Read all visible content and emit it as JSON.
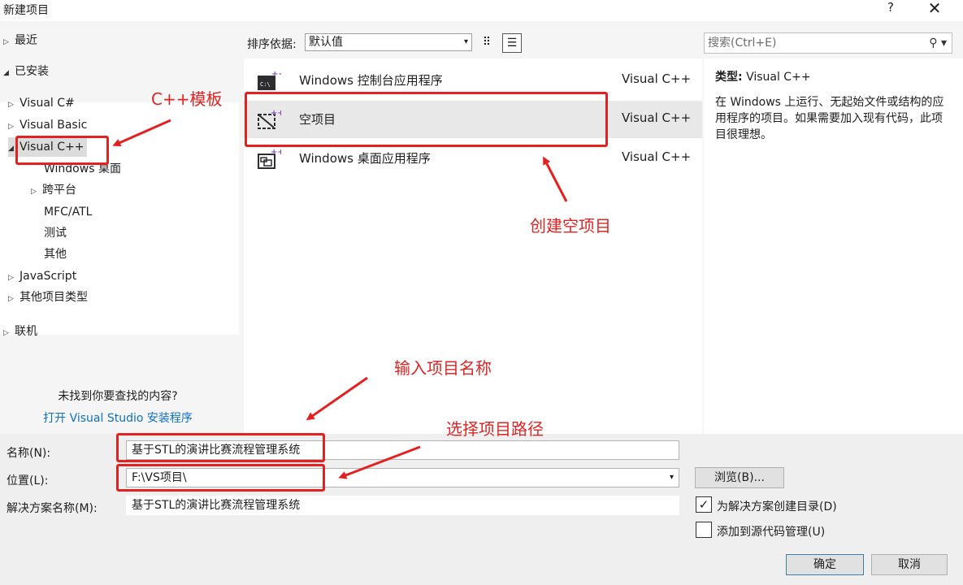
{
  "window": {
    "title": "新建项目",
    "help": "?",
    "close": "✕"
  },
  "left": {
    "recent": "最近",
    "installed": "已安装",
    "visual_csharp": "Visual C#",
    "visual_basic": "Visual Basic",
    "visual_cpp": "Visual C++",
    "windows_desktop": "Windows 桌面",
    "cross_platform": "跨平台",
    "mfc_atl": "MFC/ATL",
    "test": "测试",
    "other": "其他",
    "javascript": "JavaScript",
    "other_project_types": "其他项目类型",
    "online": "联机",
    "not_found": "未找到你要查找的内容?",
    "installer_link": "打开 Visual Studio 安装程序"
  },
  "toolbar": {
    "sort_label": "排序依据:",
    "sort_value": "默认值",
    "dropdown_glyph": "▾",
    "grid_glyph": "⠿",
    "list_glyph": "☰"
  },
  "templates": [
    {
      "name": "Windows 控制台应用程序",
      "lang": "Visual C++",
      "icon": "console-app-icon"
    },
    {
      "name": "空项目",
      "lang": "Visual C++",
      "icon": "empty-project-icon"
    },
    {
      "name": "Windows 桌面应用程序",
      "lang": "Visual C++",
      "icon": "desktop-app-icon"
    }
  ],
  "search": {
    "placeholder": "搜索(Ctrl+E)",
    "icon_glyph": "⚲ ▾"
  },
  "details": {
    "type_label": "类型:",
    "type_value": "Visual C++",
    "description": "在 Windows 上运行、无起始文件或结构的应用程序的项目。如果需要加入现有代码，此项目很理想。"
  },
  "form": {
    "name_label": "名称(N):",
    "name_value": "基于STL的演讲比赛流程管理系统",
    "location_label": "位置(L):",
    "location_value": "F:\\VS项目\\",
    "solution_label": "解决方案名称(M):",
    "solution_value": "基于STL的演讲比赛流程管理系统",
    "browse": "浏览(B)...",
    "create_dir_label": "为解决方案创建目录(D)",
    "create_dir_checked": true,
    "source_control_label": "添加到源代码管理(U)",
    "source_control_checked": false,
    "ok": "确定",
    "cancel": "取消",
    "check_glyph": "✓"
  },
  "annotations": {
    "cpp_template": "C++模板",
    "create_empty": "创建空项目",
    "enter_name": "输入项目名称",
    "choose_path": "选择项目路径",
    "color": "#e52020"
  },
  "colors": {
    "link": "#0e70c0",
    "selected_row": "#e8e8e8",
    "panel_bg": "#f5f5f5"
  }
}
